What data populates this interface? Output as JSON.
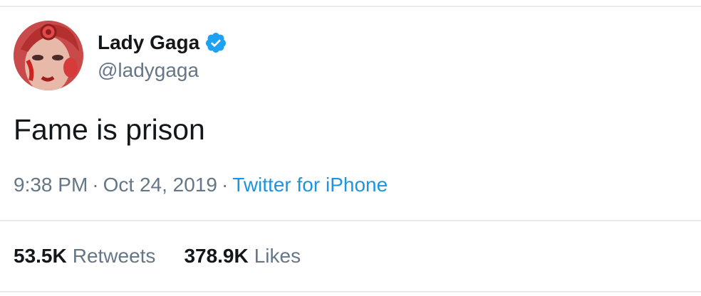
{
  "user": {
    "display_name": "Lady Gaga",
    "handle": "@ladygaga",
    "verified": true,
    "avatar_icon": "portrait-avatar"
  },
  "tweet": {
    "text": "Fame is prison",
    "time": "9:38 PM",
    "separator": "·",
    "date": "Oct 24, 2019",
    "source": "Twitter for iPhone"
  },
  "stats": {
    "retweets_count": "53.5K",
    "retweets_label": "Retweets",
    "likes_count": "378.9K",
    "likes_label": "Likes"
  },
  "colors": {
    "text": "#14171a",
    "muted": "#657786",
    "accent": "#1b95e0",
    "verified": "#1da1f2",
    "divider": "#e6ecf0"
  }
}
